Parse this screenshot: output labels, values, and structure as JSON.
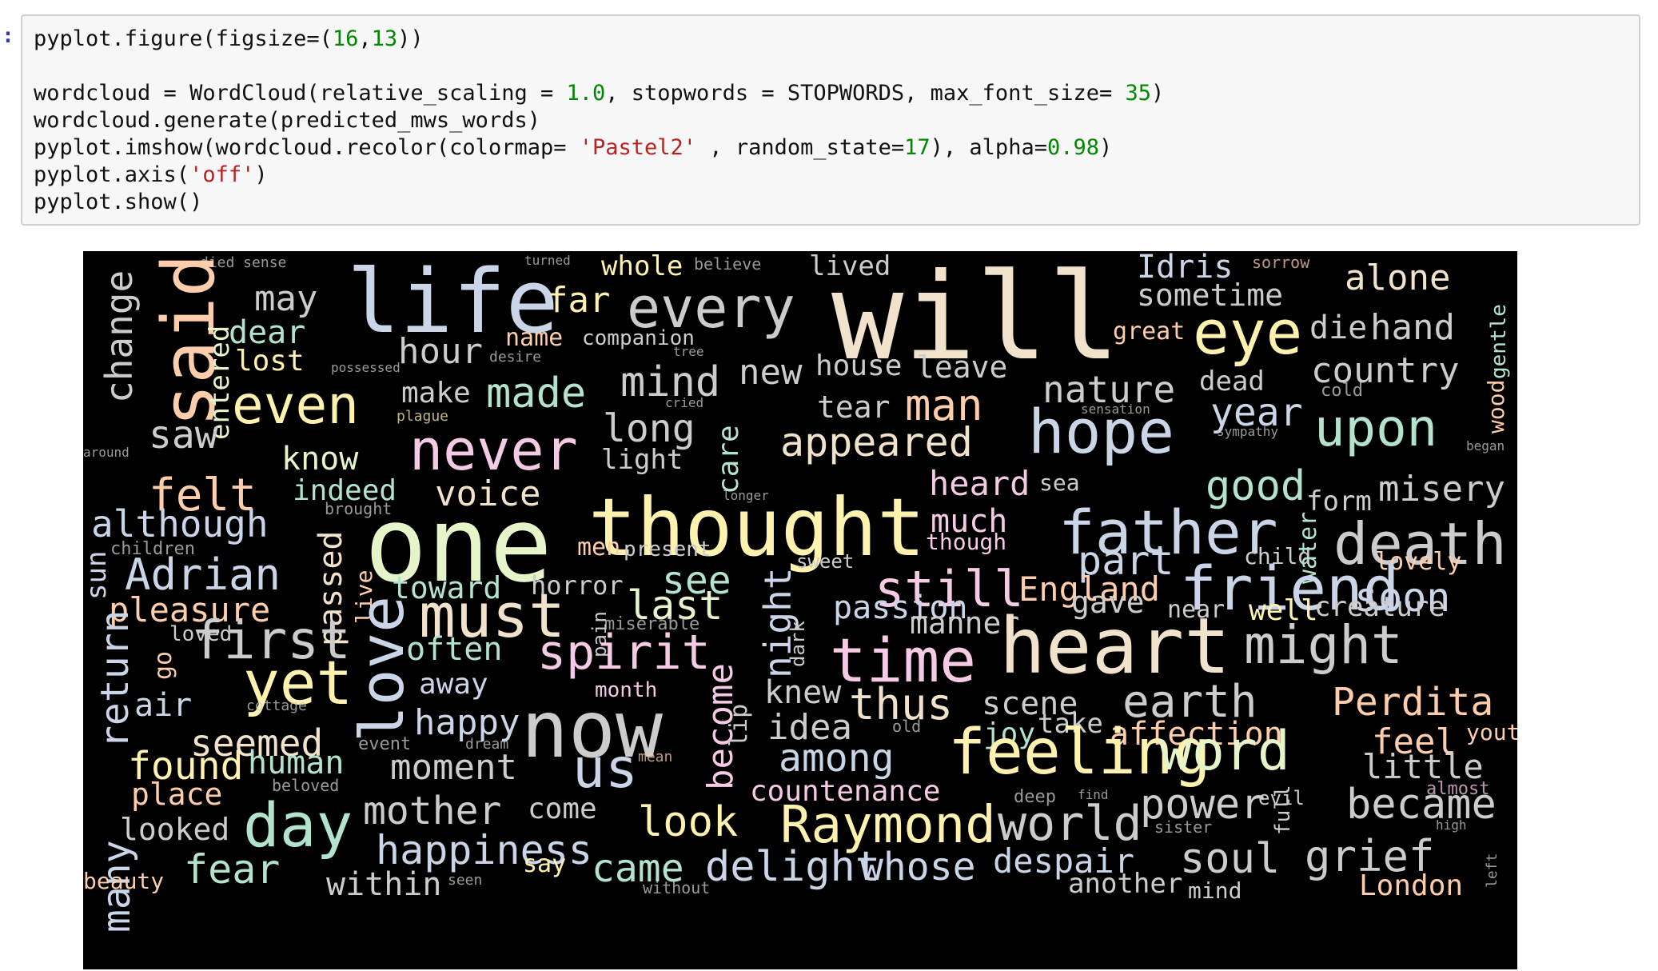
{
  "cell": {
    "prompt": ":",
    "line1": {
      "a": "pyplot.figure(figsize=(",
      "n1": "16",
      "c": ",",
      "n2": "13",
      "b": "))"
    },
    "line3": {
      "a": "wordcloud = WordCloud(relative_scaling = ",
      "n1": "1.0",
      "b": ", stopwords = STOPWORDS, max_font_size= ",
      "n2": "35",
      "c": ")"
    },
    "line4": "wordcloud.generate(predicted_mws_words)",
    "line5": {
      "a": "pyplot.imshow(wordcloud.recolor(colormap= ",
      "s": "'Pastel2'",
      "b": " , random_state=",
      "n1": "17",
      "c": "), alpha=",
      "n2": "0.98",
      "d": ")"
    },
    "line6": {
      "a": "pyplot.axis(",
      "s": "'off'",
      "b": ")"
    },
    "line7": "pyplot.show()"
  },
  "wordcloud": {
    "colors": {
      "mint": "#b3e2cd",
      "peach": "#fdcdac",
      "lavender": "#cbd5e8",
      "pink": "#f4cae4",
      "green": "#e6f5c9",
      "yellow": "#fff2ae",
      "tan": "#f1e2cc",
      "grey": "#cccccc"
    },
    "words": [
      "died sense",
      "turned",
      "whole",
      "believe",
      "lived",
      "Idris",
      "sorrow",
      "life",
      "will",
      "alone",
      "sometime",
      "may",
      "far",
      "every",
      "said",
      "change",
      "dear",
      "name",
      "companion",
      "hour",
      "eye",
      "die",
      "hand",
      "great",
      "lost",
      "possessed",
      "desire",
      "tree",
      "mind",
      "new",
      "house",
      "leave",
      "country",
      "gentle",
      "entered",
      "even",
      "make",
      "made",
      "nature",
      "dead",
      "sensation",
      "cold",
      "saw",
      "plague",
      "cried",
      "tear",
      "man",
      "year",
      "wood",
      "long",
      "hope",
      "upon",
      "around",
      "know",
      "never",
      "light",
      "appeared",
      "sympathy",
      "began",
      "care",
      "felt",
      "indeed",
      "voice",
      "longer",
      "heard",
      "sea",
      "good",
      "misery",
      "form",
      "brought",
      "although",
      "one",
      "thought",
      "much",
      "father",
      "though",
      "death",
      "children",
      "men",
      "present",
      "part",
      "child",
      "water",
      "sun",
      "Adrian",
      "sweet",
      "lovely",
      "toward",
      "horror",
      "see",
      "still",
      "England",
      "friend",
      "soon",
      "passed",
      "live",
      "pleasure",
      "loved",
      "must",
      "last",
      "passion",
      "gave",
      "near",
      "well",
      "creature",
      "miserable",
      "manner",
      "night",
      "pain",
      "dark",
      "first",
      "love",
      "often",
      "spirit",
      "time",
      "heart",
      "might",
      "return",
      "go",
      "yet",
      "away",
      "month",
      "knew",
      "cottage",
      "air",
      "become",
      "thus",
      "scene",
      "earth",
      "Perdita",
      "happy",
      "now",
      "idea",
      "old",
      "joy",
      "take",
      "affection",
      "youth",
      "seemed",
      "event",
      "dream",
      "among",
      "feeling",
      "word",
      "feel",
      "found",
      "human",
      "moment",
      "mean",
      "us",
      "lip",
      "little",
      "beloved",
      "countenance",
      "almost",
      "place",
      "deep",
      "find",
      "evil",
      "many",
      "mother",
      "come",
      "power",
      "became",
      "looked",
      "day",
      "look",
      "Raymond",
      "world",
      "sister",
      "full",
      "high",
      "happiness",
      "fear",
      "say",
      "came",
      "delight",
      "whose",
      "despair",
      "soul",
      "grief",
      "beauty",
      "within",
      "seen",
      "without",
      "another",
      "mind",
      "London",
      "left"
    ]
  }
}
